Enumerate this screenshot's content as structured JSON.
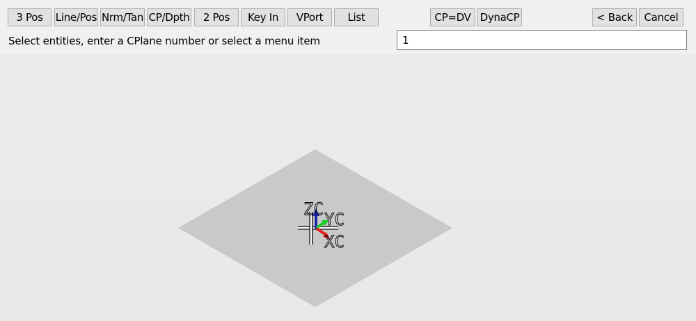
{
  "toolbar": {
    "buttons": {
      "three_pos": "3 Pos",
      "line_pos": "Line/Pos",
      "nrm_tan": "Nrm/Tan",
      "cp_dpth": "CP/Dpth",
      "two_pos": "2 Pos",
      "key_in": "Key In",
      "vport": "VPort",
      "list": "List",
      "cp_dv": "CP=DV",
      "dynacp": "DynaCP",
      "back": "< Back",
      "cancel": "Cancel"
    },
    "prompt": "Select entities, enter a CPlane number or select a menu item",
    "input_value": "1"
  },
  "viewport": {
    "axis_labels": {
      "z": "ZC",
      "y": "YC",
      "x": "XC"
    },
    "colors": {
      "plane": "#c8c8c8",
      "x_axis": "#e21e1e",
      "y_axis": "#1ecb2a",
      "z_axis": "#1b2aa8"
    }
  }
}
